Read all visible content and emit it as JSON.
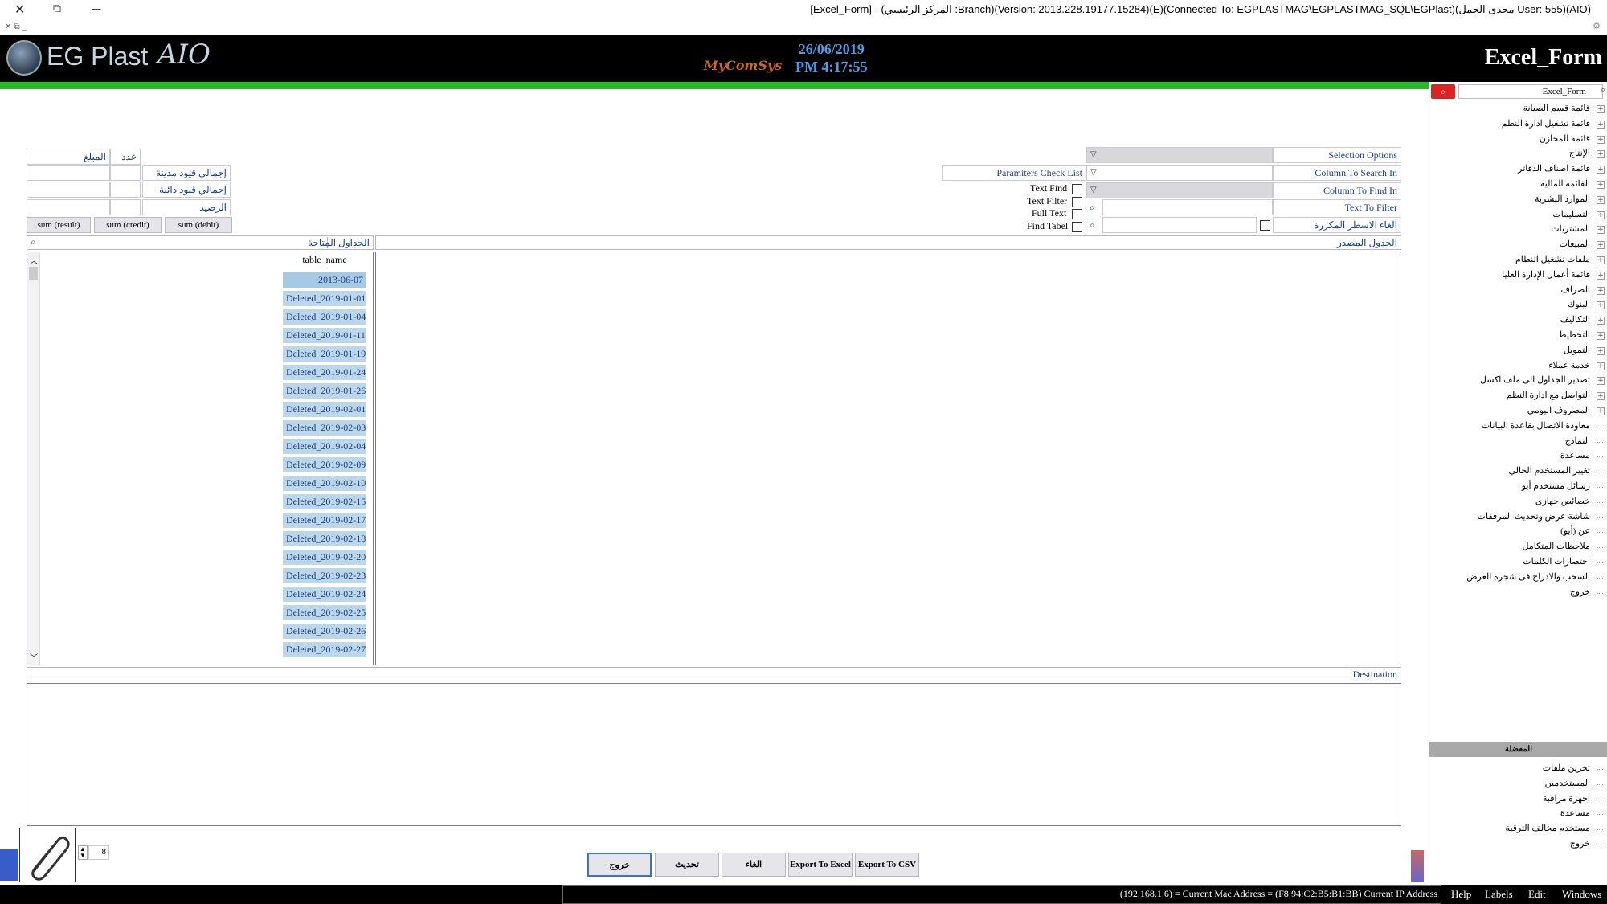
{
  "window": {
    "title": "[Excel_Form] - (المركز الرئيسي :Branch)(Version: 2013.228.19177.15284)(E)(Connected To: EGPLASTMAG\\EGPLASTMAG_SQL\\EGPlast)(مجدى الجمل User: 555)(AIO)",
    "close": "✕",
    "restore": "⧉",
    "minimize": "—"
  },
  "header": {
    "logo_text": "EG Plast",
    "logo_suffix": "AIO",
    "brand": "MyComSys",
    "date": "26/06/2019",
    "time": "PM 4:17:55",
    "form_title": "Excel_Form"
  },
  "summary": {
    "count_label": "عدد",
    "amount_label": "المبلغ",
    "debit_total_label": "إجمالي قيود مدينة",
    "credit_total_label": "إجمالي قيود دائنة",
    "balance_label": "الرصيد",
    "sum_result": "sum (result)",
    "sum_credit": "sum (credit)",
    "sum_debit": "sum (debit)"
  },
  "options": {
    "selection_options": "Selection Options",
    "column_to_search_in": "Column To Search In",
    "column_to_find_in": "Column To Find In",
    "text_to_filter": "Text To Filter",
    "remove_duplicates": "الغاء الاسطر المكررة",
    "parameters_check_list": "Paramiters Check List",
    "text_find": "Text Find",
    "text_filter": "Text Filter",
    "full_text": "Full Text",
    "find_tabel": "Find Tabel"
  },
  "tables": {
    "available_label": "الجداول المتاحة",
    "source_label": "الجدول المصدر",
    "column_header": "table_name",
    "rows": [
      "2013-06-07",
      "Deleted_2019-01-01",
      "Deleted_2019-01-04",
      "Deleted_2019-01-11",
      "Deleted_2019-01-19",
      "Deleted_2019-01-24",
      "Deleted_2019-01-26",
      "Deleted_2019-02-01",
      "Deleted_2019-02-03",
      "Deleted_2019-02-04",
      "Deleted_2019-02-09",
      "Deleted_2019-02-10",
      "Deleted_2019-02-15",
      "Deleted_2019-02-17",
      "Deleted_2019-02-18",
      "Deleted_2019-02-20",
      "Deleted_2019-02-23",
      "Deleted_2019-02-24",
      "Deleted_2019-02-25",
      "Deleted_2019-02-26",
      "Deleted_2019-02-27"
    ],
    "partial_row": "2019-02-03"
  },
  "destination": {
    "label": "Destination"
  },
  "pager": {
    "value": "8"
  },
  "buttons": {
    "exit": "خروج",
    "refresh": "تحديث",
    "cancel": "الغاء",
    "export_excel": "Export To Excel",
    "export_csv": "Export To CSV"
  },
  "sidebar": {
    "search_value": "Excel_Form",
    "tree": [
      {
        "label": "قائمة قسم الصيانة",
        "expandable": true
      },
      {
        "label": "قائمة تشغيل ادارة النظم",
        "expandable": true
      },
      {
        "label": "قائمة المخازن",
        "expandable": true
      },
      {
        "label": "الإنتاج",
        "expandable": true
      },
      {
        "label": "قائمة اصناف الدفاتر",
        "expandable": true
      },
      {
        "label": "القائمة المالية",
        "expandable": true
      },
      {
        "label": "الموارد البشرية",
        "expandable": true
      },
      {
        "label": "التسليمات",
        "expandable": true
      },
      {
        "label": "المشتريات",
        "expandable": true
      },
      {
        "label": "المبيعات",
        "expandable": true
      },
      {
        "label": "ملفات تشغيل النظام",
        "expandable": true
      },
      {
        "label": "قائمة أعمال الإدارة العليا",
        "expandable": true
      },
      {
        "label": "الصراف",
        "expandable": true
      },
      {
        "label": "البنوك",
        "expandable": true
      },
      {
        "label": "التكاليف",
        "expandable": true
      },
      {
        "label": "التخطيط",
        "expandable": true
      },
      {
        "label": "التمويل",
        "expandable": true
      },
      {
        "label": "خدمة عملاء",
        "expandable": true
      },
      {
        "label": "تصدير الجداول الى ملف اكسل",
        "expandable": true
      },
      {
        "label": "التواصل مع ادارة النظم",
        "expandable": true
      },
      {
        "label": "المصروف اليومي",
        "expandable": true
      },
      {
        "label": "معاودة الاتصال بقاعدة البيانات",
        "expandable": false
      },
      {
        "label": "النماذج",
        "expandable": false
      },
      {
        "label": "مساعدة",
        "expandable": false
      },
      {
        "label": "تغيير المستخدم الحالي",
        "expandable": false
      },
      {
        "label": "رسائل مستخدم أيو",
        "expandable": false
      },
      {
        "label": "خصائص جهازى",
        "expandable": false
      },
      {
        "label": "شاشة عرض وتحديث المرفقات",
        "expandable": false
      },
      {
        "label": "عن (أيو)",
        "expandable": false
      },
      {
        "label": "ملاحظات المتكامل",
        "expandable": false
      },
      {
        "label": "اختصارات الكلمات",
        "expandable": false
      },
      {
        "label": "السحب والادراج فى شجرة العرض",
        "expandable": false
      },
      {
        "label": "خروج",
        "expandable": false
      }
    ],
    "favorites_label": "المفضلة",
    "favorites": [
      "تخزين ملفات",
      "المستخدمين",
      "اجهزة مراقبة",
      "مساعدة",
      "مستخدم مخالف الترقية",
      "خروج"
    ]
  },
  "statusbar": {
    "info": "(192.168.1.6) = Current Mac Address = (F8:94:C2:B5:B1:BB) Current IP Address",
    "menu": [
      "Help",
      "Labels",
      "Edit",
      "Windows"
    ]
  },
  "colors": {
    "accent_green": "#22bb22",
    "header_bg": "#000000",
    "link_blue": "#1a3f8a",
    "row_blue": "#bcd6ea"
  }
}
